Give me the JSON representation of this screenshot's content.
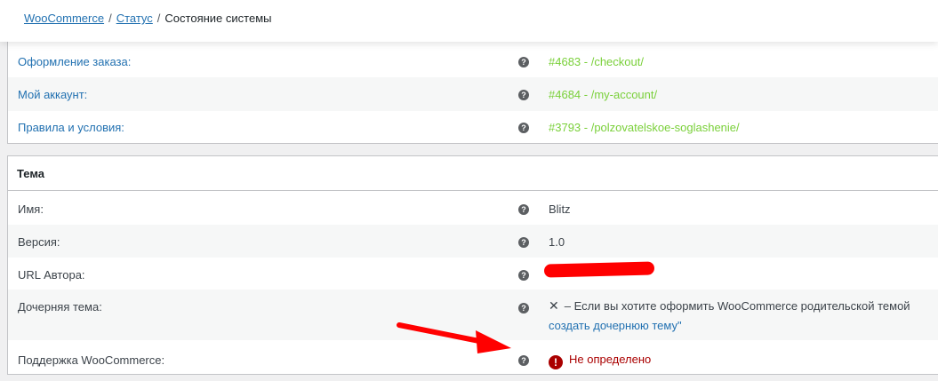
{
  "breadcrumb": {
    "root": "WooCommerce",
    "status": "Статус",
    "separator": "/",
    "current": "Состояние системы"
  },
  "pages": [
    {
      "label": "Оформление заказа:",
      "value": "#4683 - /checkout/"
    },
    {
      "label": "Мой аккаунт:",
      "value": "#4684 - /my-account/"
    },
    {
      "label": "Правила и условия:",
      "value": "#3793 - /polzovatelskoe-soglashenie/"
    }
  ],
  "theme": {
    "heading": "Тема",
    "name_label": "Имя:",
    "name_value": "Blitz",
    "version_label": "Версия:",
    "version_value": "1.0",
    "author_label": "URL Автора:",
    "child_label": "Дочерняя тема:",
    "child_x": "✕",
    "child_text": "– Если вы хотите оформить WooCommerce родительской темой",
    "child_link": "создать дочернюю тему\"",
    "support_label": "Поддержка WooCommerce:",
    "support_icon": "!",
    "support_value": "Не определено"
  },
  "help_icon": "?",
  "colors": {
    "link": "#2271b1",
    "success": "#7ad03a",
    "error": "#aa0000",
    "annotation": "#ff0000"
  }
}
